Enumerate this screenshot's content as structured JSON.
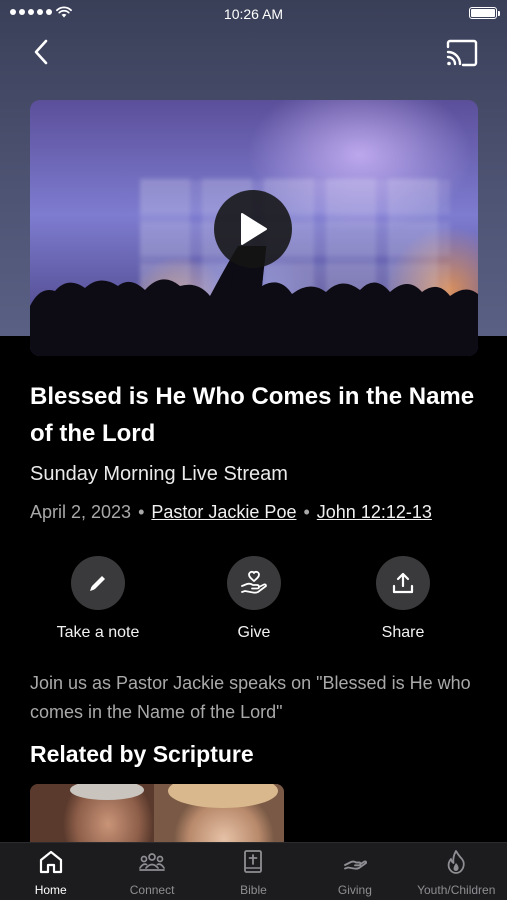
{
  "status_bar": {
    "time": "10:26 AM"
  },
  "sermon": {
    "title": "Blessed is He Who Comes in the Name of the Lord",
    "subtitle": "Sunday Morning Live Stream",
    "date": "April 2, 2023",
    "speaker": "Pastor Jackie Poe",
    "scripture": "John 12:12-13",
    "separator": "•",
    "description": "Join us as Pastor Jackie speaks on \"Blessed is He who comes in the Name of the Lord\""
  },
  "actions": [
    {
      "label": "Take a note",
      "icon": "pencil-icon"
    },
    {
      "label": "Give",
      "icon": "hand-heart-icon"
    },
    {
      "label": "Share",
      "icon": "share-icon"
    }
  ],
  "related": {
    "heading": "Related by Scripture"
  },
  "tabs": [
    {
      "label": "Home",
      "icon": "home-icon",
      "active": true
    },
    {
      "label": "Connect",
      "icon": "people-icon",
      "active": false
    },
    {
      "label": "Bible",
      "icon": "bible-icon",
      "active": false
    },
    {
      "label": "Giving",
      "icon": "giving-hand-icon",
      "active": false
    },
    {
      "label": "Youth/Children",
      "icon": "flame-icon",
      "active": false
    }
  ],
  "colors": {
    "background": "#000000",
    "hero": "#4d5372",
    "action_circle": "#3a3a3c",
    "tab_bar": "#1c1c1e",
    "muted_text": "#a9a9a9"
  }
}
